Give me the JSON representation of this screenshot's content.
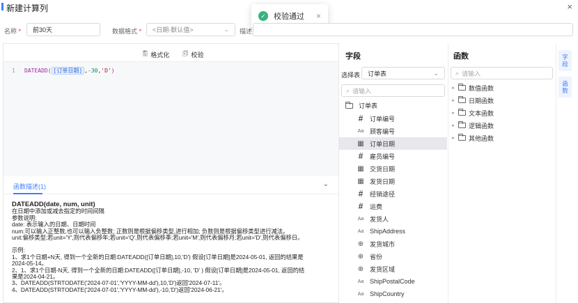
{
  "header": {
    "title": "新建计算列",
    "close_glyph": "×"
  },
  "toast": {
    "message": "校验通过",
    "check_glyph": "✓",
    "close_glyph": "×"
  },
  "form": {
    "name_label": "名称",
    "required_mark": "*",
    "name_value": "前30天",
    "format_label": "数据格式",
    "format_value": "<日期-默认值>",
    "desc_label": "描述"
  },
  "editor": {
    "toolbar": {
      "format_label": "格式化",
      "validate_label": "校验"
    },
    "line_number": "1",
    "code": {
      "fn": "DATEADD(",
      "field": "[订单日期]",
      "sep1": ",",
      "num": "-30",
      "sep2": ",",
      "str": "'D'",
      "close": ")"
    },
    "desc_tab": "函数描述(1)",
    "desc": {
      "signature": "DATEADD(date, num, unit)",
      "lines": [
        "在日期中添加或减去指定的时间间隔",
        "参数说明:",
        "date: 表示输入的日期、日期时间",
        "num:可以输入正整数,也可以输入负整数; 正数则是根据偏移类型,进行相加; 负数则是根据偏移类型进行减法。",
        "unit:偏移类型;若unit='Y',则代表偏移年;若unit='Q',则代表偏移季;若unit='M',则代表偏移月;若unit='D',则代表偏移日。",
        "",
        "示例:",
        "1、求1个日期+N天, 得到一个全新的日期:DATEADD([订单日期],10,'D') 假设[订单日期]是2024-05-01, 返回的结果是",
        "2024-05-14。",
        "2、1、求1个日期-N天, 得到一个全新的日期:DATEADD([订单日期],-10, 'D' ) 假设[订单日期]是2024-05-01, 返回的结",
        "果是2024-04-21。",
        "3、DATEADD(STRTODATE('2024-07-01','YYYY-MM-dd'),10,'D')返回'2024-07-11'。",
        "4、DATEADD(STRTODATE('2024-07-01','YYYY-MM-dd'),-10,'D')返回'2024-06-21'。"
      ]
    }
  },
  "fields_panel": {
    "title": "字段",
    "select_label": "选择表",
    "select_value": "订单表",
    "search_placeholder": "请输入",
    "table_name": "订单表",
    "items": [
      {
        "icon": "#",
        "type": "number",
        "label": "订单编号"
      },
      {
        "icon": "Aa",
        "type": "text",
        "label": "顾客编号"
      },
      {
        "icon": "date",
        "type": "date",
        "label": "订单日期"
      },
      {
        "icon": "#",
        "type": "number",
        "label": "雇员编号"
      },
      {
        "icon": "date",
        "type": "date",
        "label": "交货日期"
      },
      {
        "icon": "date",
        "type": "date",
        "label": "发货日期"
      },
      {
        "icon": "#",
        "type": "number",
        "label": "经销途径"
      },
      {
        "icon": "#",
        "type": "number",
        "label": "运费"
      },
      {
        "icon": "Aa",
        "type": "text",
        "label": "发货人"
      },
      {
        "icon": "Aa",
        "type": "text",
        "label": "ShipAddress"
      },
      {
        "icon": "globe",
        "type": "geo",
        "label": "发货城市"
      },
      {
        "icon": "globe",
        "type": "geo",
        "label": "省份"
      },
      {
        "icon": "globe",
        "type": "geo",
        "label": "发货区域"
      },
      {
        "icon": "Aa",
        "type": "text",
        "label": "ShipPostalCode"
      },
      {
        "icon": "Aa",
        "type": "text",
        "label": "ShipCountry"
      }
    ],
    "selected_label": "订单日期"
  },
  "functions_panel": {
    "title": "函数",
    "search_placeholder": "请输入",
    "categories": [
      "数值函数",
      "日期函数",
      "文本函数",
      "逻辑函数",
      "其他函数"
    ]
  },
  "side_tabs": [
    "字段",
    "函数"
  ],
  "colors": {
    "accent": "#3d7fff",
    "success": "#36b37e",
    "required": "#f5222d"
  }
}
